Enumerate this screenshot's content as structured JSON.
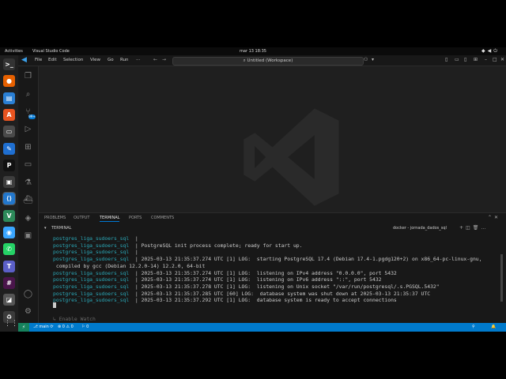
{
  "topbar": {
    "activities": "Activities",
    "app_name": "Visual Studio Code",
    "clock": "mar 13  18:35"
  },
  "dock": {
    "apps": [
      {
        "name": "terminal-icon",
        "glyph": ">_",
        "color": "#333333"
      },
      {
        "name": "firefox-icon",
        "glyph": "●",
        "color": "#e66000"
      },
      {
        "name": "writer-icon",
        "glyph": "▤",
        "color": "#2a7fd4"
      },
      {
        "name": "app-center-icon",
        "glyph": "A",
        "color": "#e95420"
      },
      {
        "name": "console-icon",
        "glyph": "▭",
        "color": "#4a4a4a"
      },
      {
        "name": "pen-icon",
        "glyph": "✎",
        "color": "#1f6fd1"
      },
      {
        "name": "pycharm-icon",
        "glyph": "P",
        "color": "#111111"
      },
      {
        "name": "images-icon",
        "glyph": "▣",
        "color": "#3d3d3d"
      },
      {
        "name": "vscode-icon",
        "glyph": "⟨⟩",
        "color": "#2277cc"
      },
      {
        "name": "vb-icon",
        "glyph": "V",
        "color": "#2d8a5a"
      },
      {
        "name": "chat-icon",
        "glyph": "◉",
        "color": "#3aa6ff"
      },
      {
        "name": "whatsapp-icon",
        "glyph": "✆",
        "color": "#25d366"
      },
      {
        "name": "teams-icon",
        "glyph": "T",
        "color": "#5b5fc7"
      },
      {
        "name": "slack-icon",
        "glyph": "#",
        "color": "#4a154b"
      },
      {
        "name": "photo-icon",
        "glyph": "◪",
        "color": "#555555"
      },
      {
        "name": "trash-icon",
        "glyph": "♻",
        "color": "#3b3b3b"
      }
    ],
    "grid_glyph": "⋮⋮⋮"
  },
  "vscode": {
    "menu": [
      "File",
      "Edit",
      "Selection",
      "View",
      "Go",
      "Run",
      "···"
    ],
    "search": "⌕  Untitled (Workspace)",
    "panel_tabs": [
      "PROBLEMS",
      "OUTPUT",
      "TERMINAL",
      "PORTS",
      "COMMENTS"
    ],
    "active_tab": "TERMINAL",
    "terminal_label": "TERMINAL",
    "shell_name": "docker - jornada_dados_sql",
    "terminal_lines": [
      {
        "svc": "postgres_liga_sudoers_sql",
        "msg": "  |"
      },
      {
        "svc": "postgres_liga_sudoers_sql",
        "msg": "  | PostgreSQL init process complete; ready for start up."
      },
      {
        "svc": "postgres_liga_sudoers_sql",
        "msg": "  |"
      },
      {
        "svc": "postgres_liga_sudoers_sql",
        "msg": "  | 2025-03-13 21:35:37.274 UTC [1] LOG:  starting PostgreSQL 17.4 (Debian 17.4-1.pgdg120+2) on x86_64-pc-linux-gnu,"
      },
      {
        "svc": "",
        "msg": " compiled by gcc (Debian 12.2.0-14) 12.2.0, 64-bit"
      },
      {
        "svc": "postgres_liga_sudoers_sql",
        "msg": "  | 2025-03-13 21:35:37.274 UTC [1] LOG:  listening on IPv4 address \"0.0.0.0\", port 5432"
      },
      {
        "svc": "postgres_liga_sudoers_sql",
        "msg": "  | 2025-03-13 21:35:37.274 UTC [1] LOG:  listening on IPv6 address \"::\", port 5432"
      },
      {
        "svc": "postgres_liga_sudoers_sql",
        "msg": "  | 2025-03-13 21:35:37.278 UTC [1] LOG:  listening on Unix socket \"/var/run/postgresql/.s.PGSQL.5432\""
      },
      {
        "svc": "postgres_liga_sudoers_sql",
        "msg": "  | 2025-03-13 21:35:37.285 UTC [60] LOG:  database system was shut down at 2025-03-13 21:35:37 UTC"
      },
      {
        "svc": "postgres_liga_sudoers_sql",
        "msg": "  | 2025-03-13 21:35:37.292 UTC [1] LOG:  database system is ready to accept connections"
      }
    ],
    "watch_hint": "↳ Enable Watch",
    "status": {
      "remote": "⚡",
      "branch": "⎇ main ⟳",
      "problems": "⊗ 0 ⚠ 0",
      "ports": "⚐ 0"
    },
    "activity_badge": "99+"
  }
}
